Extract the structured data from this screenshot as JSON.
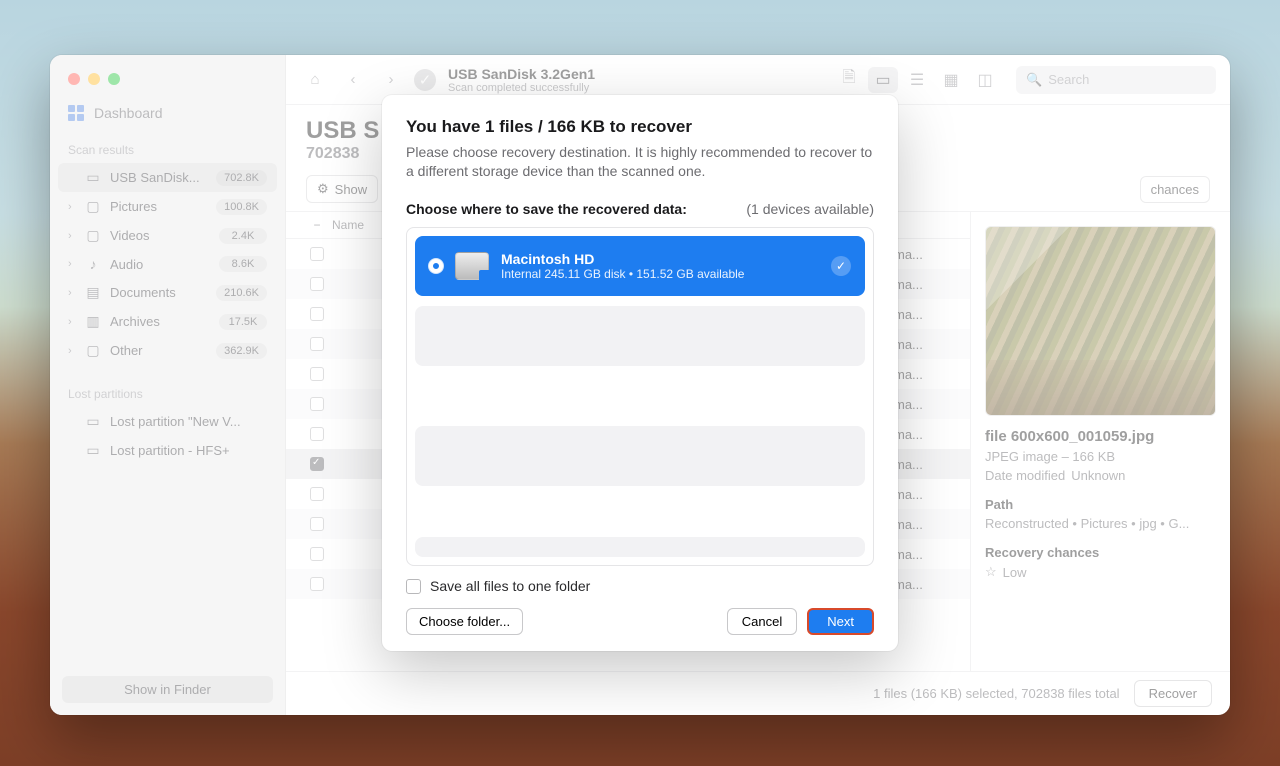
{
  "sidebar": {
    "dashboard_label": "Dashboard",
    "scan_results_label": "Scan results",
    "lost_partitions_label": "Lost partitions",
    "items": [
      {
        "label": "USB  SanDisk...",
        "count": "702.8K",
        "icon": "drive"
      },
      {
        "label": "Pictures",
        "count": "100.8K",
        "icon": "pictures"
      },
      {
        "label": "Videos",
        "count": "2.4K",
        "icon": "videos"
      },
      {
        "label": "Audio",
        "count": "8.6K",
        "icon": "audio"
      },
      {
        "label": "Documents",
        "count": "210.6K",
        "icon": "documents"
      },
      {
        "label": "Archives",
        "count": "17.5K",
        "icon": "archives"
      },
      {
        "label": "Other",
        "count": "362.9K",
        "icon": "other"
      }
    ],
    "lost_items": [
      {
        "label": "Lost partition \"New V..."
      },
      {
        "label": "Lost partition - HFS+"
      }
    ],
    "show_in_finder": "Show in Finder"
  },
  "toolbar": {
    "title": "USB  SanDisk 3.2Gen1",
    "subtitle": "Scan completed successfully",
    "search_placeholder": "Search"
  },
  "header": {
    "big_title": "USB  S",
    "big_sub": "702838"
  },
  "filters": {
    "show": "Show",
    "chances": "chances"
  },
  "list": {
    "head_name": "Name",
    "rows": [
      {
        "chance": "ma..."
      },
      {
        "chance": "ma..."
      },
      {
        "chance": "ma..."
      },
      {
        "chance": "ma..."
      },
      {
        "chance": "ma..."
      },
      {
        "chance": "ma..."
      },
      {
        "chance": "ma..."
      },
      {
        "chance": "ma...",
        "selected": true
      },
      {
        "chance": "ma..."
      },
      {
        "chance": "ma..."
      },
      {
        "chance": "ma..."
      },
      {
        "chance": "ma..."
      }
    ]
  },
  "preview": {
    "title": "file 600x600_001059.jpg",
    "kind": "JPEG image – 166 KB",
    "date_label": "Date modified",
    "date_value": "Unknown",
    "path_label": "Path",
    "path_value": "Reconstructed • Pictures • jpg • G...",
    "chances_label": "Recovery chances",
    "chances_value": "Low"
  },
  "footer": {
    "status": "1 files (166 KB) selected, 702838 files total",
    "recover": "Recover"
  },
  "modal": {
    "title": "You have 1 files / 166 KB to recover",
    "desc": "Please choose recovery destination. It is highly recommended to recover to a different storage device than the scanned one.",
    "choose_label": "Choose where to save the recovered data:",
    "devices_available": "(1 devices available)",
    "device": {
      "name": "Macintosh HD",
      "detail": "Internal 245.11 GB disk • 151.52 GB available"
    },
    "save_all": "Save all files to one folder",
    "choose_folder": "Choose folder...",
    "cancel": "Cancel",
    "next": "Next"
  }
}
